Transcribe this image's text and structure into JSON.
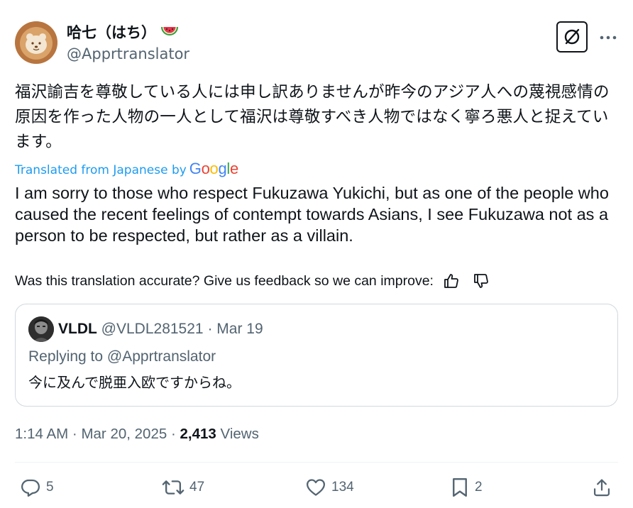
{
  "author": {
    "display_name": "哈七（はち）",
    "emoji_icon": "watermelon-icon",
    "handle": "@Apprtranslator",
    "avatar_icon": "latte-art-avatar"
  },
  "header_actions": {
    "grok_icon": "grok-icon",
    "more_icon": "more-dots-icon"
  },
  "tweet": {
    "original_text": "福沢諭吉を尊敬している人には申し訳ありませんが昨今のアジア人への蔑視感情の原因を作った人物の一人として福沢は尊敬すべき人物ではなく寧ろ悪人と捉えています。",
    "translated_from": "Translated from Japanese by",
    "translator_brand": "Google",
    "translated_text": "I am sorry to those who respect Fukuzawa Yukichi, but as one of the people who caused the recent feelings of contempt towards Asians, I see Fukuzawa not as a person to be respected, but rather as a villain.",
    "feedback_prompt": "Was this translation accurate? Give us feedback so we can improve:"
  },
  "quote": {
    "name": "VLDL",
    "handle": "@VLDL281521",
    "separator": "·",
    "date": "Mar 19",
    "replying_to": "Replying to @Apprtranslator",
    "text": "今に及んで脱亜入欧ですからね。"
  },
  "meta": {
    "time": "1:14 AM",
    "separator": "·",
    "date": "Mar 20, 2025",
    "views_count": "2,413",
    "views_label": "Views"
  },
  "actions": {
    "replies": "5",
    "reposts": "47",
    "likes": "134",
    "bookmarks": "2"
  },
  "colors": {
    "text": "#0f1419",
    "secondary": "#536471",
    "link": "#1d9bf0",
    "border": "#cfd9de",
    "divider": "#eff3f4"
  }
}
